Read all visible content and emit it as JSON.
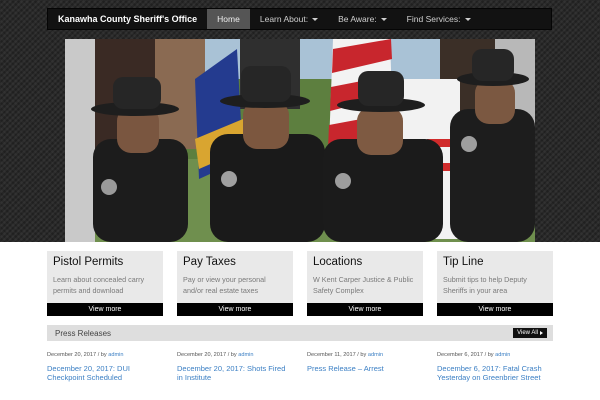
{
  "navbar": {
    "brand": "Kanawha County Sheriff's Office",
    "items": [
      {
        "label": "Home",
        "active": true,
        "has_caret": false
      },
      {
        "label": "Learn About:",
        "active": false,
        "has_caret": true
      },
      {
        "label": "Be Aware:",
        "active": false,
        "has_caret": true
      },
      {
        "label": "Find Services:",
        "active": false,
        "has_caret": true
      }
    ]
  },
  "hero": {
    "icons": [
      "deputy-honor-guard-photo"
    ]
  },
  "cards": [
    {
      "title": "Pistol Permits",
      "description": "Learn about concealed carry permits and download",
      "button": "View more"
    },
    {
      "title": "Pay Taxes",
      "description": "Pay or view your personal and/or real estate taxes",
      "button": "View more"
    },
    {
      "title": "Locations",
      "description": "W Kent Carper Justice & Public Safety Complex",
      "button": "View more"
    },
    {
      "title": "Tip Line",
      "description": "Submit tips to help Deputy Sheriffs in your area",
      "button": "View more"
    }
  ],
  "press": {
    "title": "Press Releases",
    "view_all": "View All",
    "posts": [
      {
        "date": "December 20, 2017",
        "by": " / by ",
        "author": "admin",
        "title": "December 20, 2017: DUI Checkpoint Scheduled"
      },
      {
        "date": "December 20, 2017",
        "by": " / by ",
        "author": "admin",
        "title": "December 20, 2017: Shots Fired in Institute"
      },
      {
        "date": "December 11, 2017",
        "by": " / by ",
        "author": "admin",
        "title": "Press Release – Arrest"
      },
      {
        "date": "December 6, 2017",
        "by": " / by ",
        "author": "admin",
        "title": "December 6, 2017: Fatal Crash Yesterday on Greenbrier Street"
      }
    ]
  },
  "colors": {
    "link": "#3b7fc4",
    "card_bg": "#e9e9e9",
    "button_bg": "#000000",
    "navbar_bg": "#121212",
    "active_nav": "#555555"
  }
}
